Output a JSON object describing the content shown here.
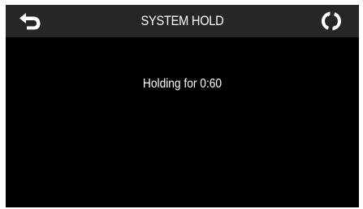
{
  "header": {
    "title": "SYSTEM HOLD",
    "back_icon": "back-arrow-icon",
    "refresh_icon": "refresh-icon"
  },
  "main": {
    "message": "Holding for 0:60"
  },
  "colors": {
    "screen_background": "#000000",
    "header_background": "#262626",
    "text": "#ffffff"
  }
}
